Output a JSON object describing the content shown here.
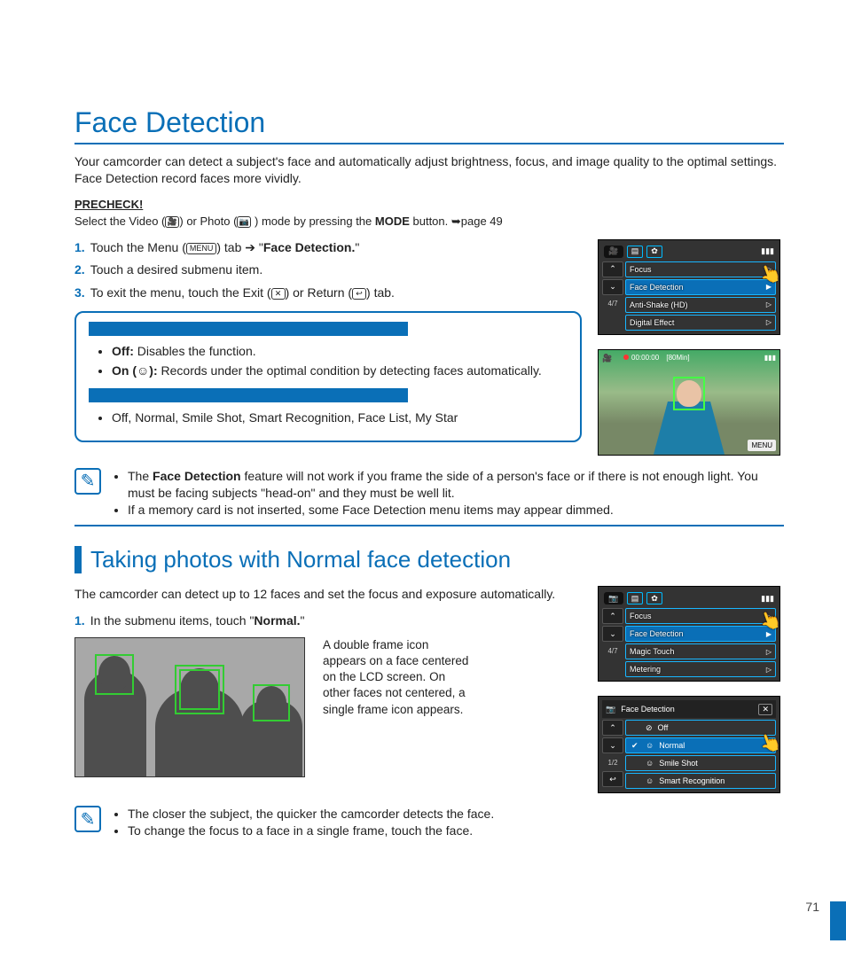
{
  "page_number": "71",
  "title": "Face Detection",
  "intro": "Your camcorder can detect a subject's face and automatically adjust brightness, focus, and image quality to the optimal settings. Face Detection record faces more vividly.",
  "precheck_label": "PRECHECK!",
  "precheck": {
    "prefix": "Select the Video (",
    "mid1": ") or Photo (",
    "mid2": " ) mode by pressing the ",
    "mode_word": "MODE",
    "suffix": " button. ➥page 49"
  },
  "steps": [
    {
      "n": "1.",
      "pre": "Touch the Menu (",
      "chip": "MENU",
      "post": ") tab ➔ \"",
      "bold": "Face Detection.",
      "end": "\""
    },
    {
      "n": "2.",
      "text": "Touch a desired submenu item."
    },
    {
      "n": "3.",
      "pre": "To exit the menu, touch the Exit (",
      "chip1": "✕",
      "mid": ") or Return (",
      "chip2": "↩",
      "post": ") tab."
    }
  ],
  "submenu": {
    "off_label": "Off:",
    "off_text": " Disables the function.",
    "on_label": "On (",
    "on_icon": "☺",
    "on_label2": "):",
    "on_text": " Records under the optimal condition by detecting faces automatically.",
    "options": "Off, Normal, Smile Shot, Smart Recognition, Face List, My Star"
  },
  "note1": [
    "The Face Detection feature will not work if you frame the side of a person's face or if there is not enough light. You must be facing subjects \"head-on\" and they must be well lit.",
    "If a memory card is not inserted, some Face Detection menu items may appear dimmed."
  ],
  "note1_bold": "Face Detection",
  "subtitle": "Taking photos with Normal face detection",
  "sub_intro": "The camcorder can detect up to 12 faces and set the focus and exposure automatically.",
  "substep": {
    "n": "1.",
    "pre": "In the submenu items, touch \"",
    "bold": "Normal.",
    "post": "\""
  },
  "caption": "A double frame icon appears on a face centered on the LCD screen. On other faces not centered, a single frame icon appears.",
  "note2": [
    "The closer the subject, the quicker the camcorder detects the face.",
    "To change the focus to a face in a single frame, touch the face."
  ],
  "lcd_menu1": {
    "page": "4/7",
    "items": [
      "Focus",
      "Face Detection",
      "Anti-Shake (HD)",
      "Digital Effect"
    ],
    "selected": 1
  },
  "lcd_preview": {
    "time": "00:00:00",
    "remain": "[80Min]",
    "menu": "MENU"
  },
  "lcd_menu2": {
    "page": "4/7",
    "items": [
      "Focus",
      "Face Detection",
      "Magic Touch",
      "Metering"
    ],
    "selected": 1
  },
  "lcd_fd": {
    "title": "Face Detection",
    "page": "1/2",
    "items": [
      {
        "icon": "⊘",
        "label": "Off"
      },
      {
        "icon": "☺",
        "label": "Normal"
      },
      {
        "icon": "☺",
        "label": "Smile Shot"
      },
      {
        "icon": "☺",
        "label": "Smart Recognition"
      }
    ],
    "selected": 1
  }
}
